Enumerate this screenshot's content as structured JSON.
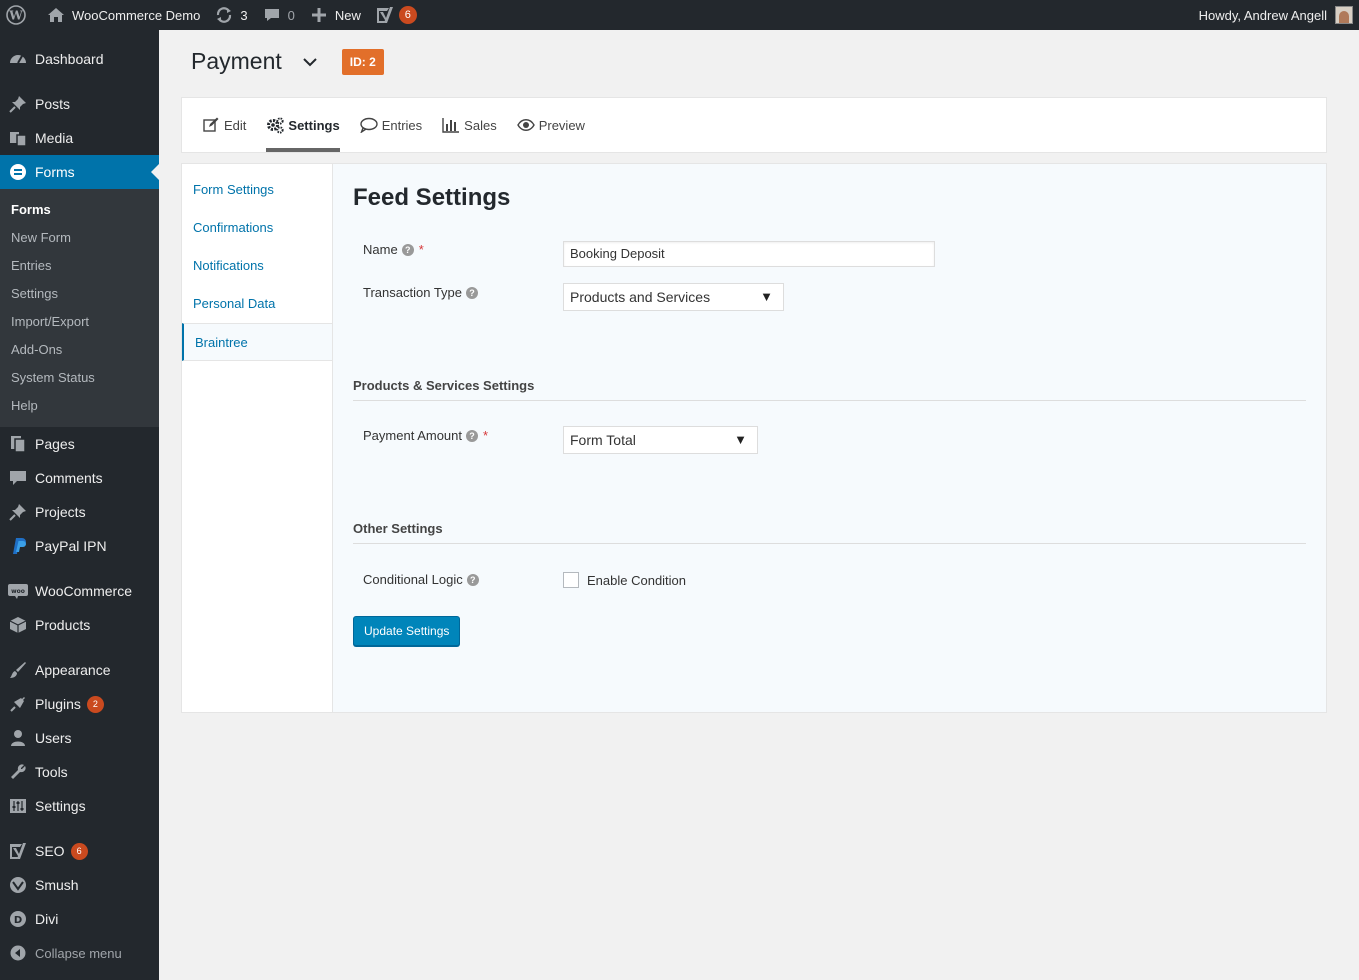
{
  "adminbar": {
    "site_name": "WooCommerce Demo",
    "updates_count": "3",
    "comments_count": "0",
    "new_label": "New",
    "seo_count": "6",
    "greeting": "Howdy, Andrew Angell"
  },
  "sidebar": {
    "dashboard": "Dashboard",
    "posts": "Posts",
    "media": "Media",
    "forms": "Forms",
    "submenu": [
      "Forms",
      "New Form",
      "Entries",
      "Settings",
      "Import/Export",
      "Add-Ons",
      "System Status",
      "Help"
    ],
    "pages": "Pages",
    "comments": "Comments",
    "projects": "Projects",
    "paypal": "PayPal IPN",
    "woocommerce": "WooCommerce",
    "products": "Products",
    "appearance": "Appearance",
    "plugins": "Plugins",
    "plugins_count": "2",
    "users": "Users",
    "tools": "Tools",
    "settings": "Settings",
    "seo": "SEO",
    "seo_count": "6",
    "smush": "Smush",
    "divi": "Divi",
    "collapse": "Collapse menu"
  },
  "header": {
    "title": "Payment",
    "id_badge": "ID: 2"
  },
  "toolbar": {
    "edit": "Edit",
    "settings": "Settings",
    "entries": "Entries",
    "sales": "Sales",
    "preview": "Preview"
  },
  "subnav": [
    "Form Settings",
    "Confirmations",
    "Notifications",
    "Personal Data",
    "Braintree"
  ],
  "feed": {
    "heading": "Feed Settings",
    "name_label": "Name",
    "name_value": "Booking Deposit",
    "transaction_label": "Transaction Type",
    "transaction_value": "Products and Services",
    "products_section": "Products & Services Settings",
    "amount_label": "Payment Amount",
    "amount_value": "Form Total",
    "other_section": "Other Settings",
    "conditional_label": "Conditional Logic",
    "enable_condition": "Enable Condition",
    "update_button": "Update Settings"
  },
  "colors": {
    "admin_dark": "#23282d",
    "accent": "#0073aa",
    "badge": "#ca4a1f",
    "id_badge": "#e26f2a",
    "button": "#0085ba"
  }
}
